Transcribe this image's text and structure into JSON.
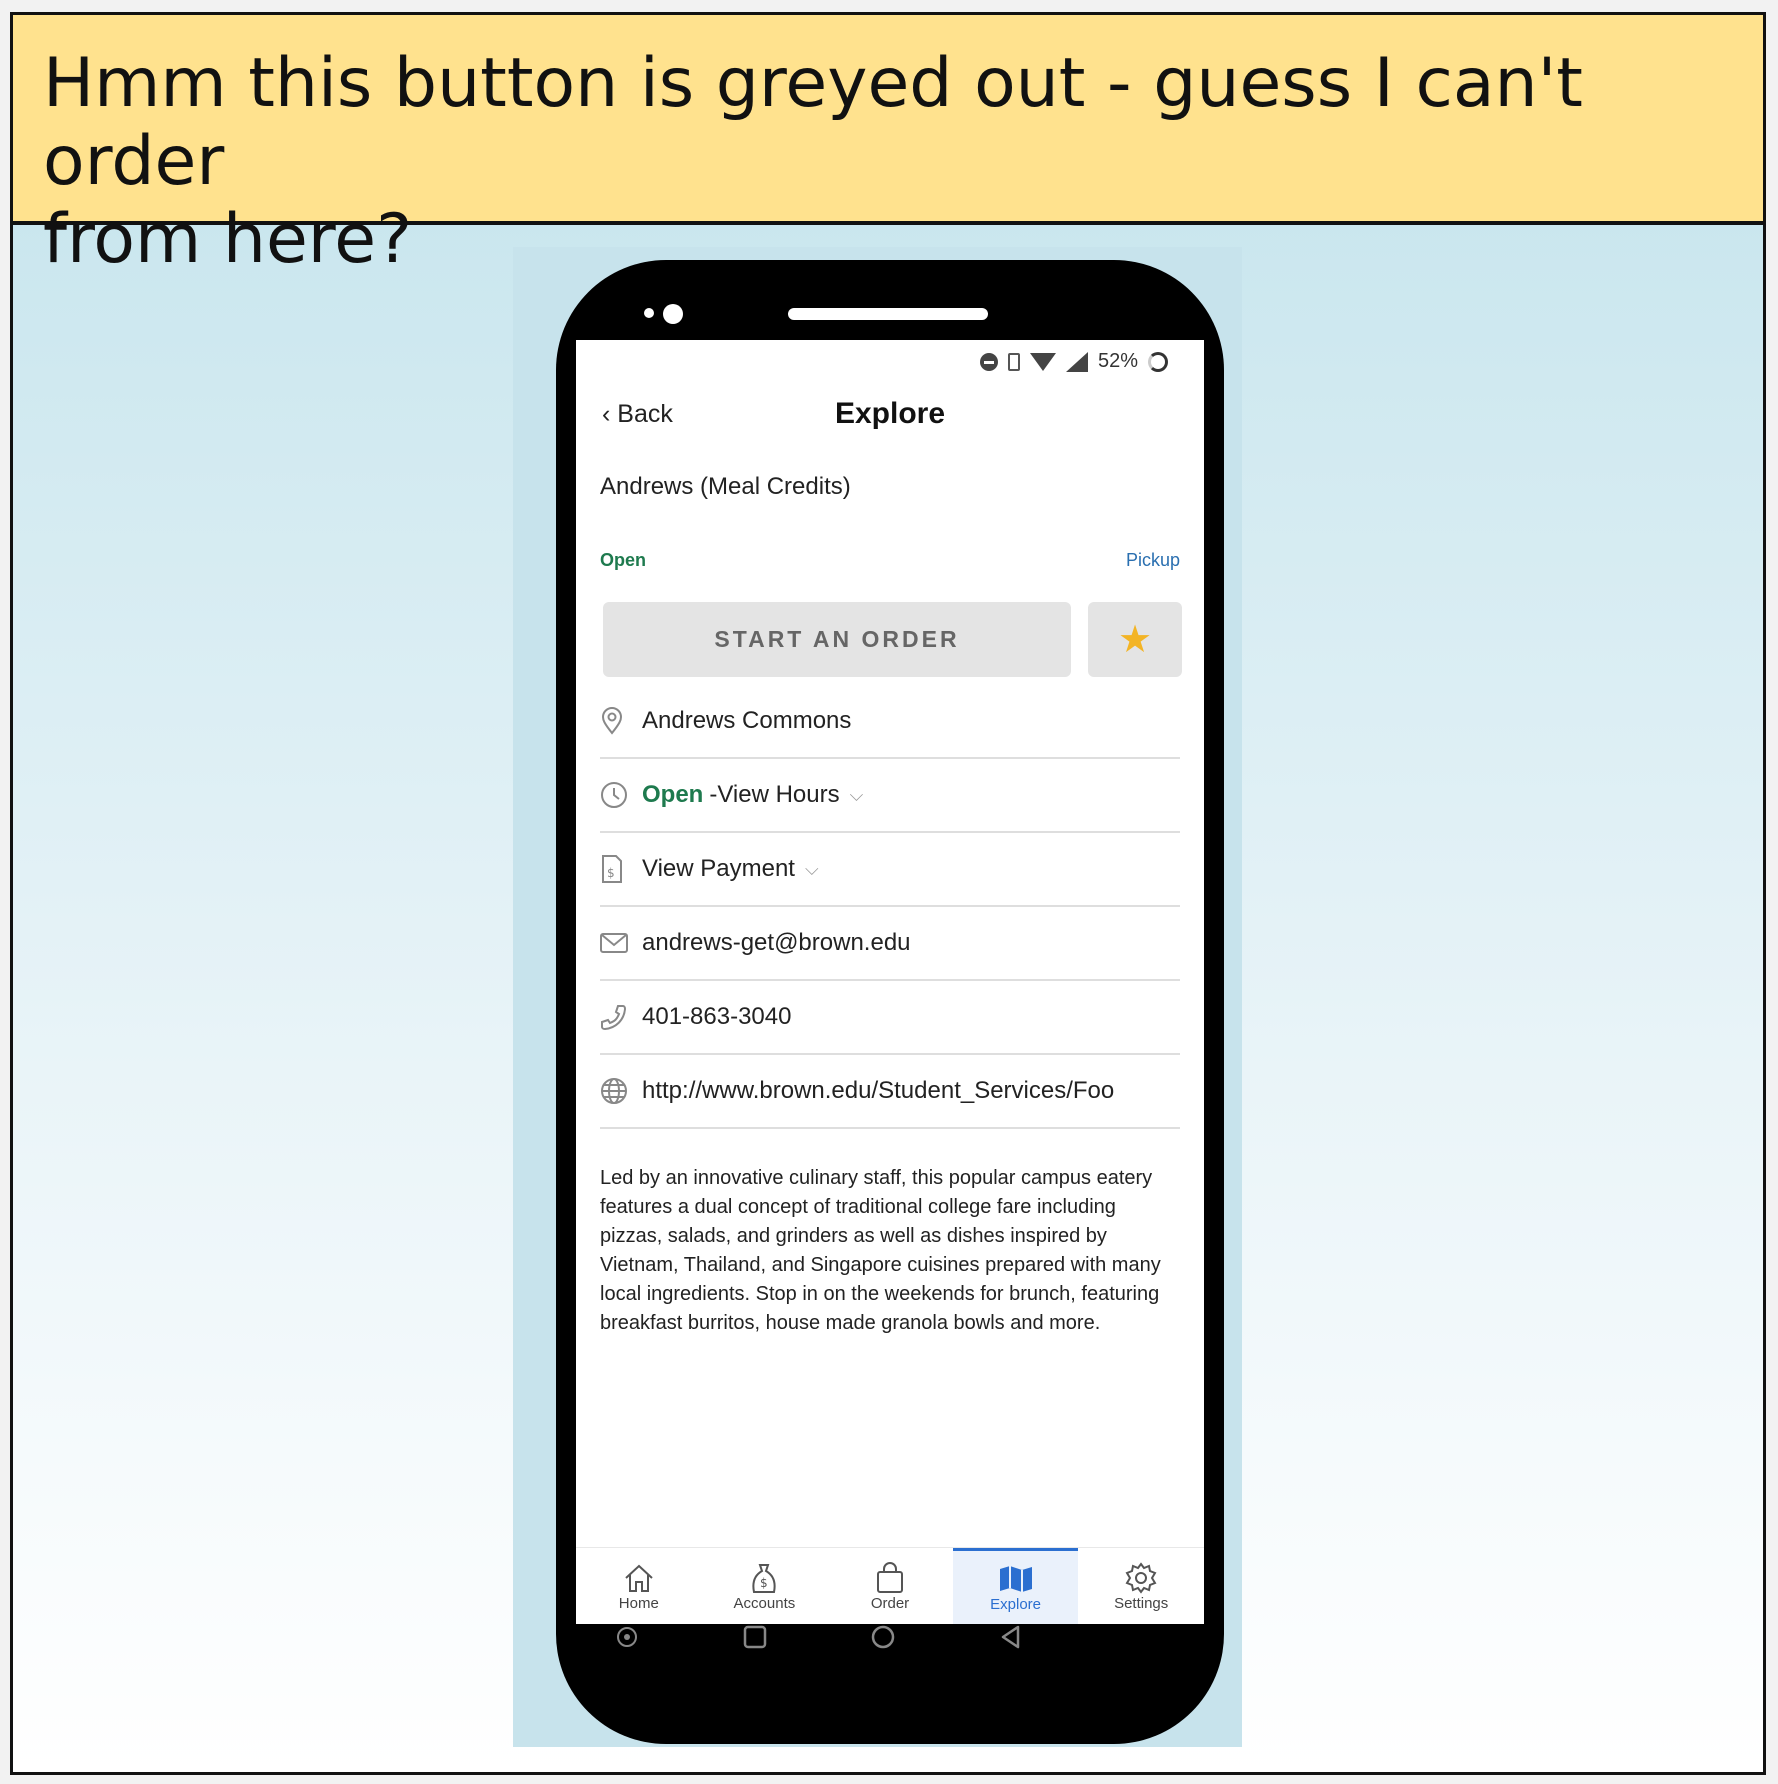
{
  "caption": {
    "line1": "Hmm this button is greyed out - guess I can't order",
    "line2": "from here?"
  },
  "status_bar": {
    "battery": "52%"
  },
  "header": {
    "back_label": "Back",
    "title": "Explore"
  },
  "venue": {
    "name": "Andrews (Meal Credits)",
    "status": "Open",
    "service_type": "Pickup"
  },
  "actions": {
    "start_order_label": "START AN ORDER",
    "favorite_icon": "star-icon"
  },
  "details": {
    "location": "Andrews Commons",
    "hours_status": "Open",
    "hours_link": "-View Hours",
    "payment_link": "View Payment",
    "email": "andrews-get@brown.edu",
    "phone": "401-863-3040",
    "website": "http://www.brown.edu/Student_Services/Foo"
  },
  "description": "Led by an innovative culinary staff, this popular campus eatery features a dual concept of traditional college fare including pizzas, salads, and grinders as well as dishes inspired by Vietnam, Thailand, and Singapore cuisines prepared with many local ingredients. Stop in on the weekends for brunch, featuring breakfast burritos, house made granola bowls and more.",
  "tabs": [
    {
      "label": "Home",
      "icon": "home-icon"
    },
    {
      "label": "Accounts",
      "icon": "money-bag-icon"
    },
    {
      "label": "Order",
      "icon": "shopping-bag-icon"
    },
    {
      "label": "Explore",
      "icon": "map-icon",
      "active": true
    },
    {
      "label": "Settings",
      "icon": "gear-icon"
    }
  ],
  "colors": {
    "caption_bg": "#ffe28e",
    "accent_blue": "#2b6fd0",
    "open_green": "#1e7a4e",
    "star_gold": "#f3b425",
    "disabled_button": "#e4e4e4"
  }
}
